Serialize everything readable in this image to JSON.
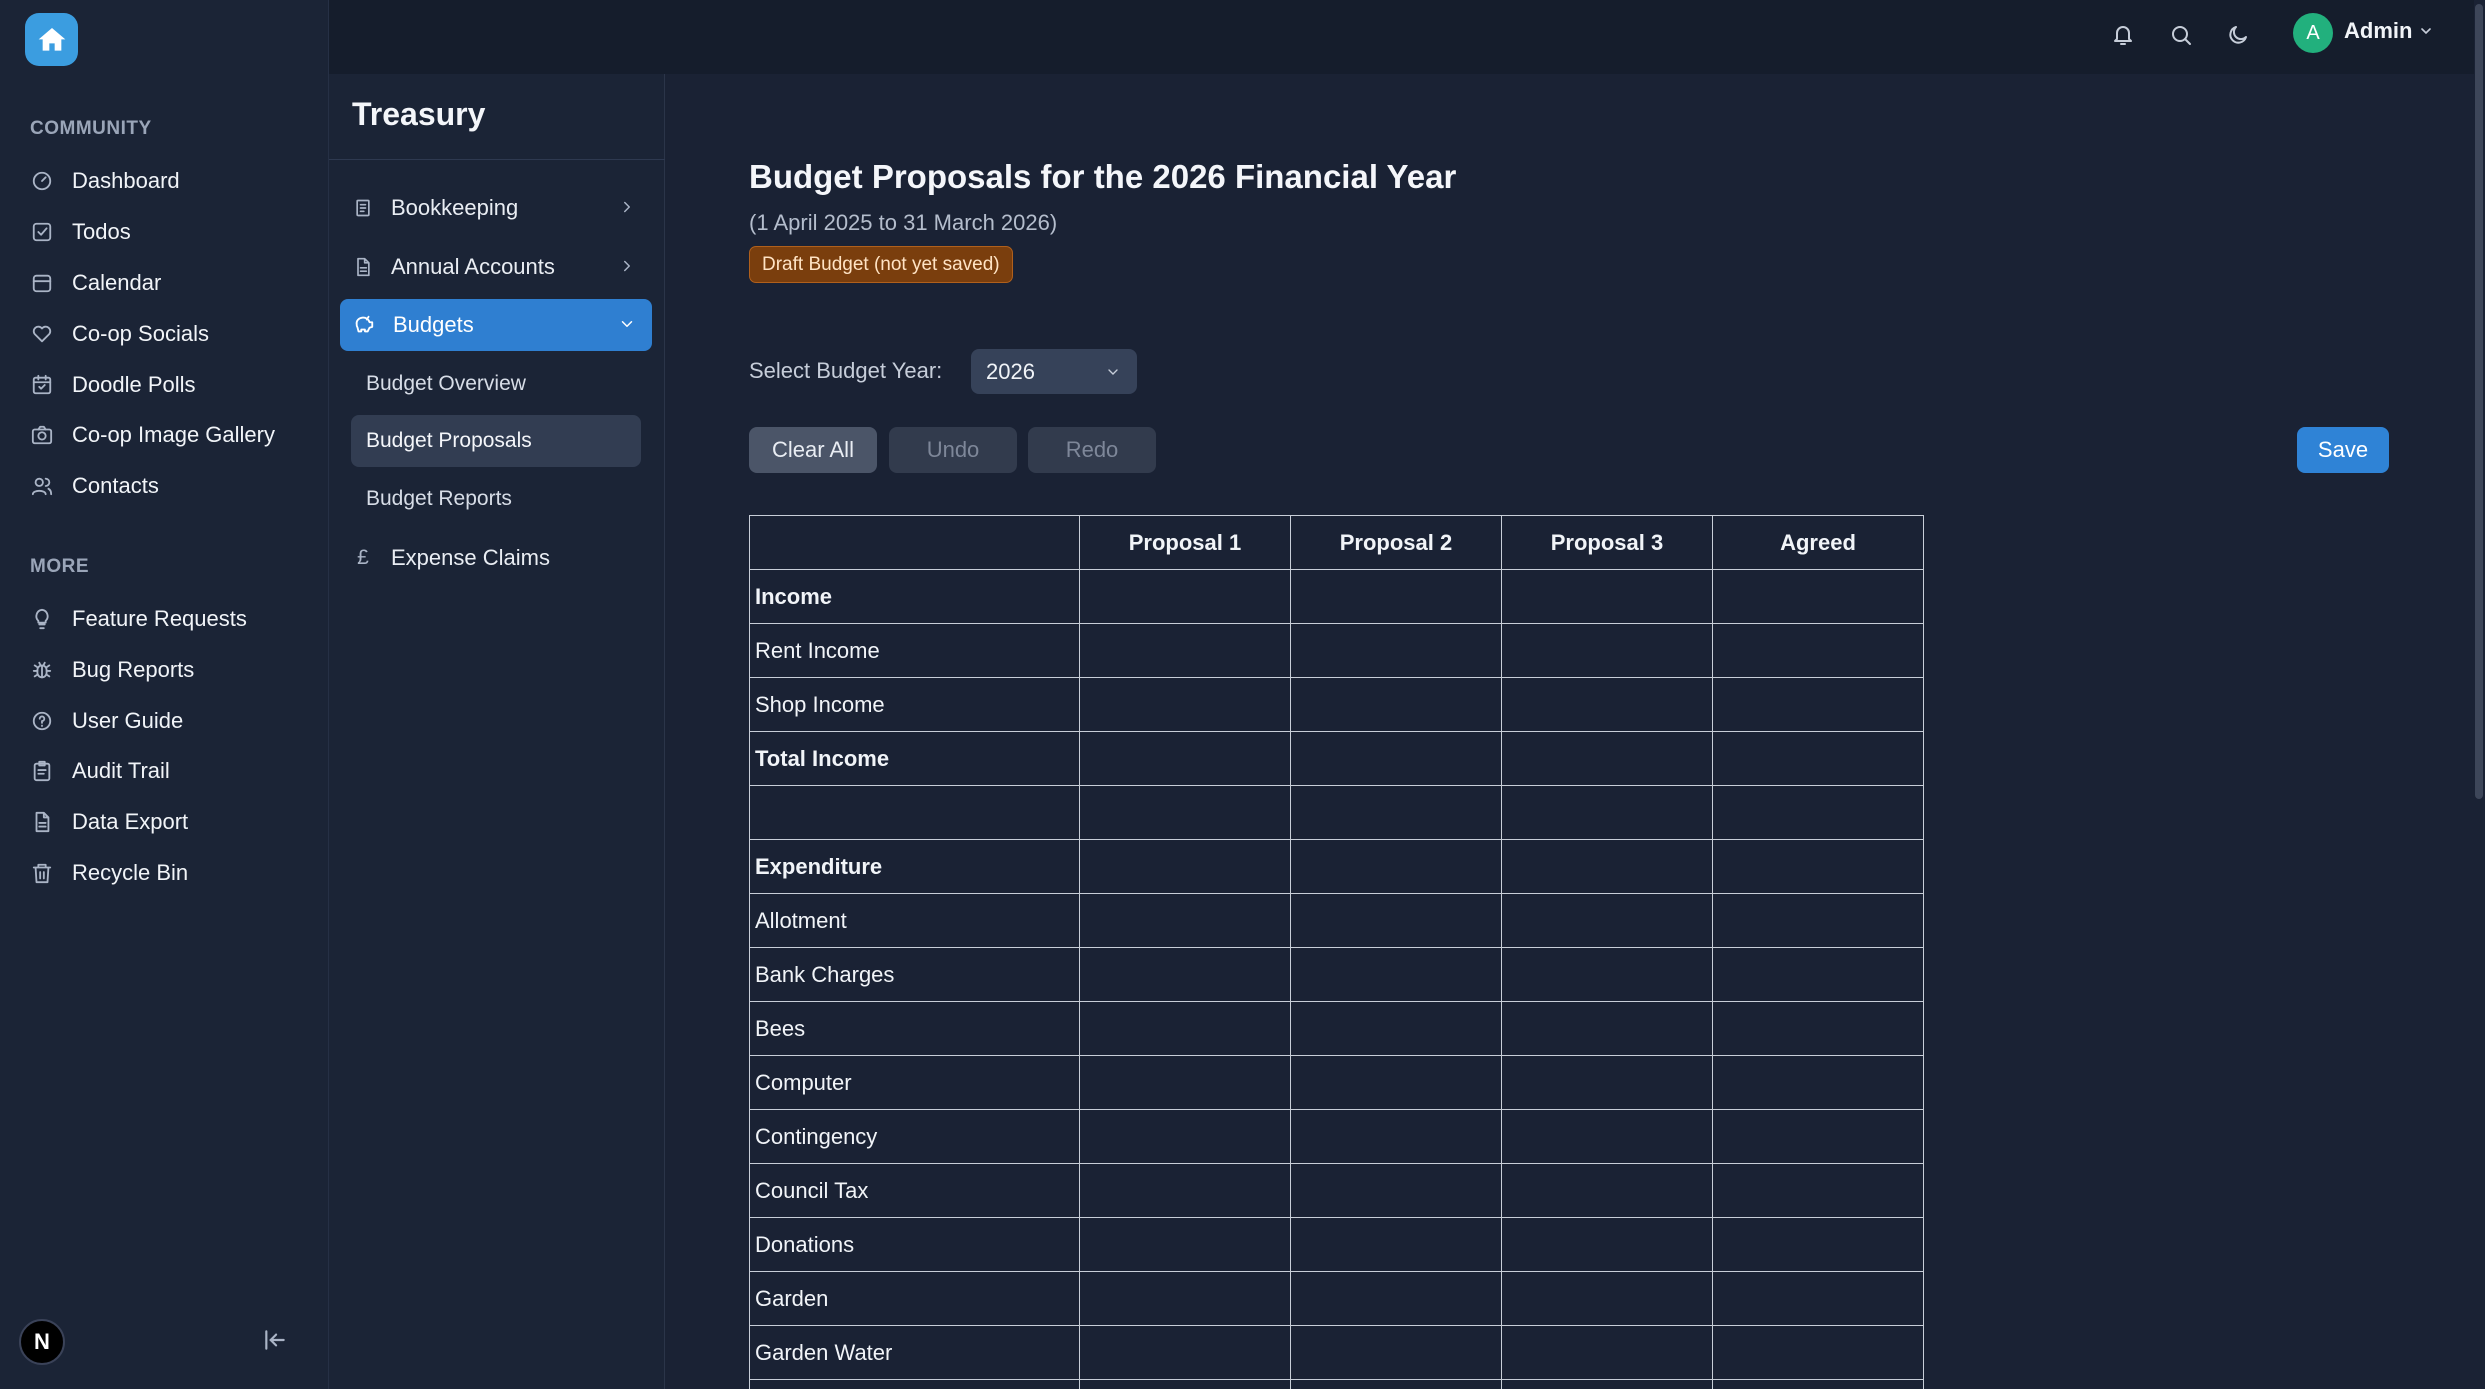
{
  "sidebar": {
    "section_community": "COMMUNITY",
    "community_items": [
      {
        "label": "Dashboard",
        "icon": "dashboard-icon"
      },
      {
        "label": "Todos",
        "icon": "checkbox-icon"
      },
      {
        "label": "Calendar",
        "icon": "calendar-icon"
      },
      {
        "label": "Co-op Socials",
        "icon": "heart-icon"
      },
      {
        "label": "Doodle Polls",
        "icon": "calendar-check-icon"
      },
      {
        "label": "Co-op Image Gallery",
        "icon": "camera-icon"
      },
      {
        "label": "Contacts",
        "icon": "users-icon"
      }
    ],
    "section_more": "MORE",
    "more_items": [
      {
        "label": "Feature Requests",
        "icon": "lightbulb-icon"
      },
      {
        "label": "Bug Reports",
        "icon": "bug-icon"
      },
      {
        "label": "User Guide",
        "icon": "help-circle-icon"
      },
      {
        "label": "Audit Trail",
        "icon": "clipboard-icon"
      },
      {
        "label": "Data Export",
        "icon": "file-icon"
      },
      {
        "label": "Recycle Bin",
        "icon": "trash-icon"
      }
    ],
    "badge_letter": "N"
  },
  "topbar": {
    "user_initial": "A",
    "user_name": "Admin"
  },
  "treasury": {
    "title": "Treasury",
    "items": [
      {
        "label": "Bookkeeping"
      },
      {
        "label": "Annual Accounts"
      },
      {
        "label": "Budgets"
      }
    ],
    "budget_children": [
      "Budget Overview",
      "Budget Proposals",
      "Budget Reports"
    ],
    "expense_claims": "Expense Claims",
    "currency_symbol": "£"
  },
  "main": {
    "title": "Budget Proposals for the 2026 Financial Year",
    "subtitle": "(1 April 2025 to 31 March 2026)",
    "draft_badge": "Draft Budget (not yet saved)",
    "year_label": "Select Budget Year:",
    "year_value": "2026",
    "buttons": {
      "clear": "Clear All",
      "undo": "Undo",
      "redo": "Redo",
      "save": "Save"
    }
  },
  "table": {
    "columns": [
      "",
      "Proposal 1",
      "Proposal 2",
      "Proposal 3",
      "Agreed"
    ],
    "rows": [
      {
        "label": "Income",
        "bold": true
      },
      {
        "label": "Rent Income",
        "bold": false
      },
      {
        "label": "Shop Income",
        "bold": false
      },
      {
        "label": "Total Income",
        "bold": true
      },
      {
        "label": "",
        "bold": false
      },
      {
        "label": "Expenditure",
        "bold": true
      },
      {
        "label": "Allotment",
        "bold": false
      },
      {
        "label": "Bank Charges",
        "bold": false
      },
      {
        "label": "Bees",
        "bold": false
      },
      {
        "label": "Computer",
        "bold": false
      },
      {
        "label": "Contingency",
        "bold": false
      },
      {
        "label": "Council Tax",
        "bold": false
      },
      {
        "label": "Donations",
        "bold": false
      },
      {
        "label": "Garden",
        "bold": false
      },
      {
        "label": "Garden Water",
        "bold": false
      },
      {
        "label": "",
        "bold": false
      }
    ]
  }
}
